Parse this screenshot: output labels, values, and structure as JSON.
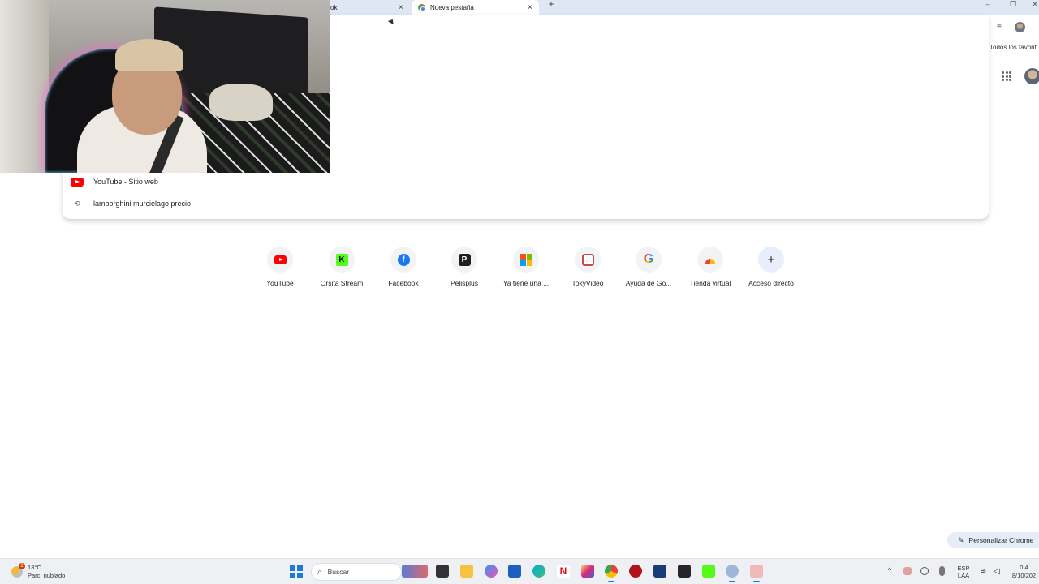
{
  "tabs": [
    {
      "title": "ok",
      "close": "×"
    },
    {
      "title": "Nueva pestaña",
      "close": "×"
    }
  ],
  "new_tab": "+",
  "window_controls": {
    "minimize": "–",
    "restore": "❐",
    "close": "✕"
  },
  "bookmarks": {
    "all_label": "Todos los favorit"
  },
  "omnibox": {
    "suggestions": [
      {
        "icon": "youtube-icon",
        "text": "YouTube - Sitio web"
      },
      {
        "icon": "history-icon",
        "text": "lamborghini murcielago precio"
      }
    ]
  },
  "shortcuts": [
    {
      "label": "YouTube",
      "icon": "youtube-icon"
    },
    {
      "label": "Orsita Stream",
      "icon": "kick-icon"
    },
    {
      "label": "Facebook",
      "icon": "facebook-icon"
    },
    {
      "label": "Pelisplus",
      "icon": "pelisplus-icon"
    },
    {
      "label": "Ya tiene una ...",
      "icon": "microsoft-icon"
    },
    {
      "label": "TokyVideo",
      "icon": "tokyvideo-icon"
    },
    {
      "label": "Ayuda de Go...",
      "icon": "google-icon"
    },
    {
      "label": "Tienda virtual",
      "icon": "store-icon"
    },
    {
      "label": "Acceso directo",
      "icon": "plus-icon"
    }
  ],
  "customize": {
    "label": "Personalizar Chrome"
  },
  "taskbar": {
    "weather": {
      "temp": "13°C",
      "condition": "Parc. nublado",
      "badge": "2"
    },
    "search_label": "Buscar",
    "lang": {
      "line1": "ESP",
      "line2": "LAA"
    },
    "clock": {
      "time": "0:4",
      "date": "8/10/202"
    }
  }
}
